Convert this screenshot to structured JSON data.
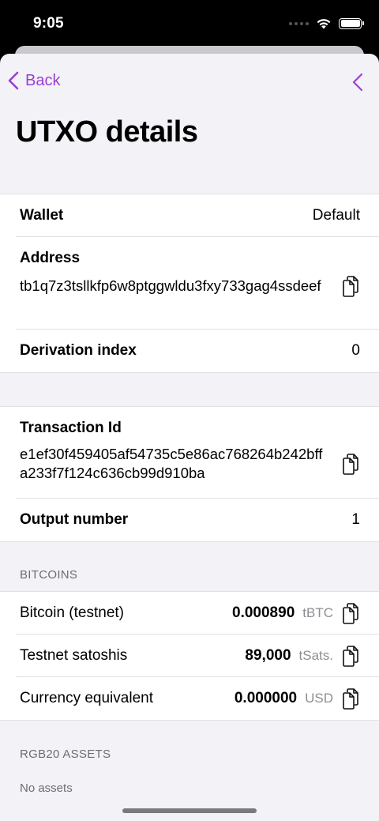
{
  "status_bar": {
    "time": "9:05"
  },
  "nav": {
    "back_label": "Back"
  },
  "title": "UTXO details",
  "wallet_group": {
    "wallet_label": "Wallet",
    "wallet_value": "Default",
    "address_label": "Address",
    "address_value": "tb1q7z3tsllkfp6w8ptggwldu3fxy733gag4ssdeef",
    "derivation_label": "Derivation index",
    "derivation_value": "0"
  },
  "tx_group": {
    "txid_label": "Transaction Id",
    "txid_value": "e1ef30f459405af54735c5e86ac768264b242bffa233f7f124c636cb99d910ba",
    "output_label": "Output number",
    "output_value": "1"
  },
  "bitcoins": {
    "header": "BITCOINS",
    "rows": [
      {
        "label": "Bitcoin (testnet)",
        "amount": "0.000890",
        "unit": "tBTC"
      },
      {
        "label": "Testnet satoshis",
        "amount": "89,000",
        "unit": "tSats."
      },
      {
        "label": "Currency equivalent",
        "amount": "0.000000",
        "unit": "USD"
      }
    ]
  },
  "rgb20": {
    "header": "RGB20 ASSETS",
    "empty_text": "No assets"
  },
  "colors": {
    "accent": "#9a3fd6",
    "grouped_background": "#f2f2f7",
    "secondary_text": "#8e8e93"
  }
}
